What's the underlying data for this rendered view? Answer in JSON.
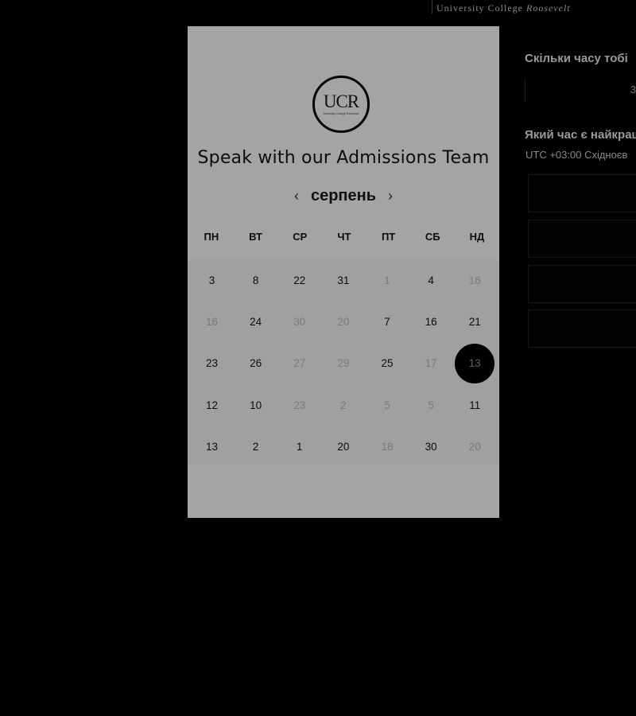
{
  "brand": {
    "text_upright": "University College ",
    "text_italic": "Roosevelt"
  },
  "right_panel": {
    "question_duration": "Скільки часу тобі",
    "duration_value": "3",
    "question_time": "Який час є найкраш",
    "timezone": "UTC +03:00 Східноєв"
  },
  "modal": {
    "logo_text": "UCR",
    "logo_subtext": "University College Roosevelt",
    "title": "Speak with our Admissions Team",
    "month": "серпень",
    "prev_icon": "‹",
    "next_icon": "›",
    "weekdays": [
      "ПН",
      "ВТ",
      "СР",
      "ЧТ",
      "ПТ",
      "СБ",
      "НД"
    ],
    "weeks": [
      [
        {
          "d": "3"
        },
        {
          "d": "8"
        },
        {
          "d": "22"
        },
        {
          "d": "31"
        },
        {
          "d": "1",
          "muted": true
        },
        {
          "d": "4"
        },
        {
          "d": "16",
          "muted": true
        }
      ],
      [
        {
          "d": "16",
          "muted": true
        },
        {
          "d": "24"
        },
        {
          "d": "30",
          "muted": true
        },
        {
          "d": "20",
          "muted": true
        },
        {
          "d": "7"
        },
        {
          "d": "16"
        },
        {
          "d": "21"
        }
      ],
      [
        {
          "d": "23"
        },
        {
          "d": "26"
        },
        {
          "d": "27",
          "muted": true
        },
        {
          "d": "29",
          "muted": true
        },
        {
          "d": "25"
        },
        {
          "d": "17",
          "muted": true
        },
        {
          "d": "13",
          "selected": true
        }
      ],
      [
        {
          "d": "12"
        },
        {
          "d": "10"
        },
        {
          "d": "23",
          "muted": true
        },
        {
          "d": "2",
          "muted": true
        },
        {
          "d": "5",
          "muted": true
        },
        {
          "d": "5",
          "muted": true
        },
        {
          "d": "11"
        }
      ],
      [
        {
          "d": "13"
        },
        {
          "d": "2"
        },
        {
          "d": "1"
        },
        {
          "d": "20"
        },
        {
          "d": "18",
          "muted": true
        },
        {
          "d": "30"
        },
        {
          "d": "20",
          "muted": true
        }
      ]
    ]
  }
}
